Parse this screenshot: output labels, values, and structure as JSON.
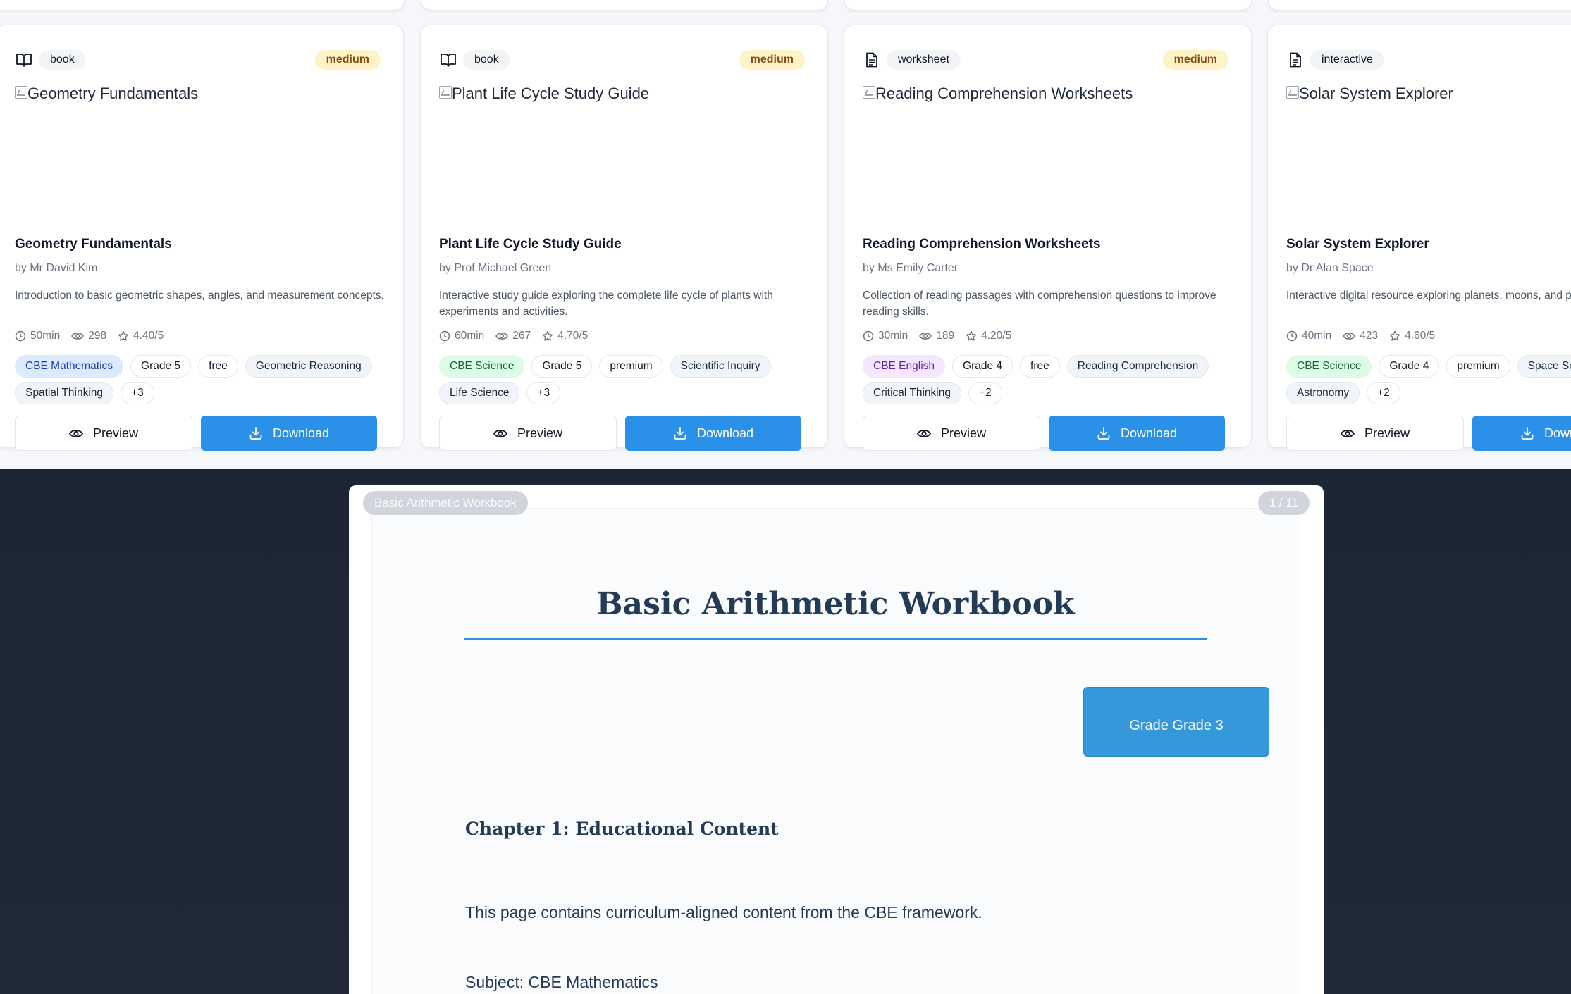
{
  "cards": [
    {
      "type": "book",
      "type_icon": "book-open-icon",
      "level": "medium",
      "image_alt": "Geometry Fundamentals",
      "title": "Geometry Fundamentals",
      "author": "by Mr David Kim",
      "description": "Introduction to basic geometric shapes, angles, and measurement concepts.",
      "duration": "50min",
      "views": "298",
      "rating": "4.40/5",
      "tags": [
        "CBE Mathematics",
        "Grade 5",
        "free",
        "Geometric Reasoning",
        "Spatial Thinking",
        "+3"
      ],
      "preview_label": "Preview",
      "download_label": "Download"
    },
    {
      "type": "book",
      "type_icon": "book-open-icon",
      "level": "medium",
      "image_alt": "Plant Life Cycle Study Guide",
      "title": "Plant Life Cycle Study Guide",
      "author": "by Prof Michael Green",
      "description": "Interactive study guide exploring the complete life cycle of plants with experiments and activities.",
      "duration": "60min",
      "views": "267",
      "rating": "4.70/5",
      "tags": [
        "CBE Science",
        "Grade 5",
        "premium",
        "Scientific Inquiry",
        "Life Science",
        "+3"
      ],
      "preview_label": "Preview",
      "download_label": "Download"
    },
    {
      "type": "worksheet",
      "type_icon": "document-icon",
      "level": "medium",
      "image_alt": "Reading Comprehension Worksheets",
      "title": "Reading Comprehension Worksheets",
      "author": "by Ms Emily Carter",
      "description": "Collection of reading passages with comprehension questions to improve reading skills.",
      "duration": "30min",
      "views": "189",
      "rating": "4.20/5",
      "tags": [
        "CBE English",
        "Grade 4",
        "free",
        "Reading Comprehension",
        "Critical Thinking",
        "+2"
      ],
      "preview_label": "Preview",
      "download_label": "Download"
    },
    {
      "type": "interactive",
      "type_icon": "document-icon",
      "level": "",
      "image_alt": "Solar System Explorer",
      "title": "Solar System Explorer",
      "author": "by Dr Alan Space",
      "description": "Interactive digital resource exploring planets, moons, and phenomena.",
      "duration": "40min",
      "views": "423",
      "rating": "4.60/5",
      "tags": [
        "CBE Science",
        "Grade 4",
        "premium",
        "Space Science",
        "Astronomy",
        "+2"
      ],
      "preview_label": "Preview",
      "download_label": "Download"
    }
  ],
  "viewer": {
    "doc_title_chip": "Basic Arithmetic Workbook",
    "page_indicator": "1 / 11",
    "heading": "Basic Arithmetic Workbook",
    "grade_box": "Grade Grade 3",
    "chapter": "Chapter 1: Educational Content",
    "paragraph_1": "This page contains curriculum-aligned content from the CBE framework.",
    "paragraph_2": "Subject: CBE Mathematics"
  },
  "colors": {
    "accent": "#2a90e8",
    "viewer_bg": "#1f2937",
    "level_badge_bg": "#fef3c7",
    "heading_text": "#243b55"
  }
}
